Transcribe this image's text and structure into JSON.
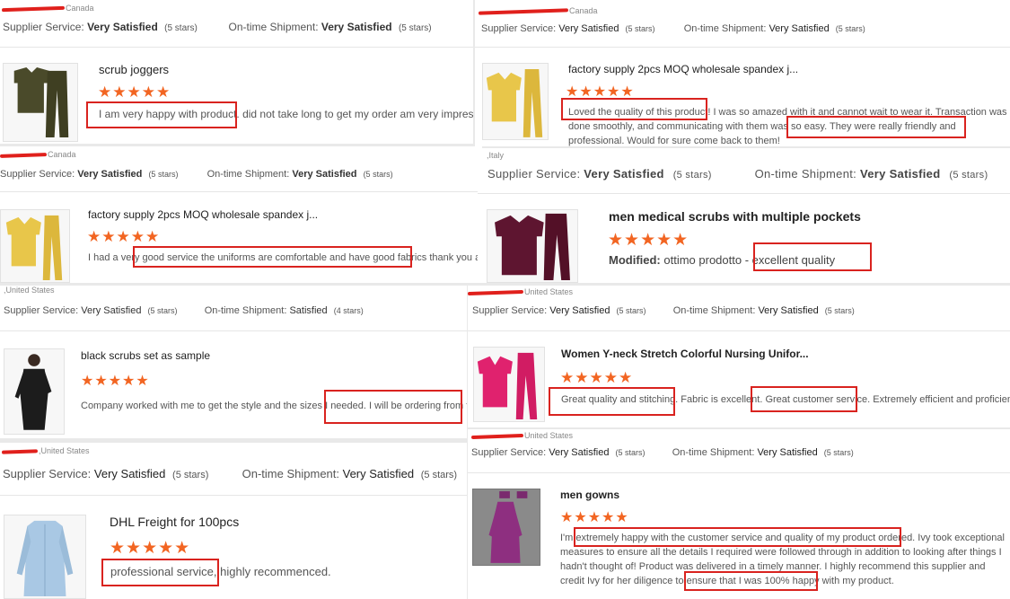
{
  "labels": {
    "supplier_service": "Supplier Service:",
    "ontime_shipment": "On-time Shipment:",
    "very_satisfied": "Very Satisfied",
    "satisfied": "Satisfied",
    "five_stars": "(5 stars)",
    "four_stars": "(4 stars)",
    "modified": "Modified:"
  },
  "colors": {
    "highlight": "#d9231f",
    "star": "#f26522"
  },
  "reviews": [
    {
      "country": "Canada",
      "supplier_service": "Very Satisfied",
      "supplier_stars": "(5 stars)",
      "shipment": "Very Satisfied",
      "shipment_stars": "(5 stars)",
      "product": "scrub joggers",
      "rating": 5,
      "stars": "★★★★★",
      "text_highlight": "I am very happy with product.",
      "text_rest": " did not take long to get my order am very impress",
      "image": "olive-scrub-set"
    },
    {
      "country": "Canada",
      "supplier_service": "Very Satisfied",
      "supplier_stars": "(5 stars)",
      "shipment": "Very Satisfied",
      "shipment_stars": "(5 stars)",
      "product": "factory supply 2pcs MOQ wholesale spandex j...",
      "rating": 5,
      "stars": "★★★★★",
      "text_pre": "I had a very ",
      "text_highlight": "good service the uniforms are comfortable and have good fabrics",
      "text_rest": " thank you again",
      "image": "yellow-scrub-set"
    },
    {
      "country": ",United States",
      "supplier_service": "Very Satisfied",
      "supplier_stars": "(5 stars)",
      "shipment": "Satisfied",
      "shipment_stars": "(4 stars)",
      "product": "black scrubs set as sample",
      "rating": 5,
      "stars": "★★★★★",
      "text_pre": "Company worked with me to get the style and the sizes I needed. ",
      "text_highlight": "I will be ordering from them again.",
      "image": "black-scrub-coat"
    },
    {
      "country": ",United States",
      "supplier_service": "Very Satisfied",
      "supplier_stars": "(5 stars)",
      "shipment": "Very Satisfied",
      "shipment_stars": "(5 stars)",
      "product": "DHL Freight for 100pcs",
      "rating": 5,
      "stars": "★★★★★",
      "text_highlight": "professional service,",
      "text_rest": " highly recommenced.",
      "image": "blue-lab-coat"
    },
    {
      "country": "Canada",
      "supplier_service": "Very Satisfied",
      "supplier_stars": "(5 stars)",
      "shipment": "Very Satisfied",
      "shipment_stars": "(5 stars)",
      "product": "factory supply 2pcs MOQ wholesale spandex j...",
      "rating": 5,
      "stars": "★★★★★",
      "text_highlight": "Loved the quality of this product!",
      "text_mid": " I was so amazed with it and cannot wait to wear it. Transaction was done smoothly, and communicating with them was so easy. ",
      "text_highlight2": "They were really friendly and professional.",
      "text_rest": " Would for sure come back to them!",
      "image": "yellow-scrub-set"
    },
    {
      "country": ",Italy",
      "supplier_service": "Very Satisfied",
      "supplier_stars": "(5 stars)",
      "shipment": "Very Satisfied",
      "shipment_stars": "(5 stars)",
      "product": "men medical scrubs with multiple pockets",
      "rating": 5,
      "stars": "★★★★★",
      "text_label": "Modified:",
      "text_pre": " ottimo prodotto ",
      "text_highlight": "- excellent quality",
      "image": "burgundy-scrub-set"
    },
    {
      "country": "United States",
      "supplier_service": "Very Satisfied",
      "supplier_stars": "(5 stars)",
      "shipment": "Very Satisfied",
      "shipment_stars": "(5 stars)",
      "product": "Women Y-neck Stretch Colorful Nursing Unifor...",
      "rating": 5,
      "stars": "★★★★★",
      "text_highlight": "Great quality and stitching.",
      "text_mid": " Fabric is excellent. ",
      "text_highlight2": "Great customer service.",
      "text_rest": " Extremely efficient and proficient!",
      "image": "pink-scrub-set"
    },
    {
      "country": "United States",
      "supplier_service": "Very Satisfied",
      "supplier_stars": "(5 stars)",
      "shipment": "Very Satisfied",
      "shipment_stars": "(5 stars)",
      "product": "men gowns",
      "rating": 5,
      "stars": "★★★★★",
      "text_pre": "I'm ",
      "text_highlight": "extremely happy with the customer service and quality of my product ordered.",
      "text_mid": " Ivy took exceptional measures to ensure all the details I required were followed through in addition to looking after things I hadn't thought of! Product was delivered in a timely manner. I highly recommend this supplier and credit Ivy for her diligence to ensure that I was ",
      "text_highlight2": "100% happy with my product.",
      "image": "purple-gown"
    }
  ]
}
